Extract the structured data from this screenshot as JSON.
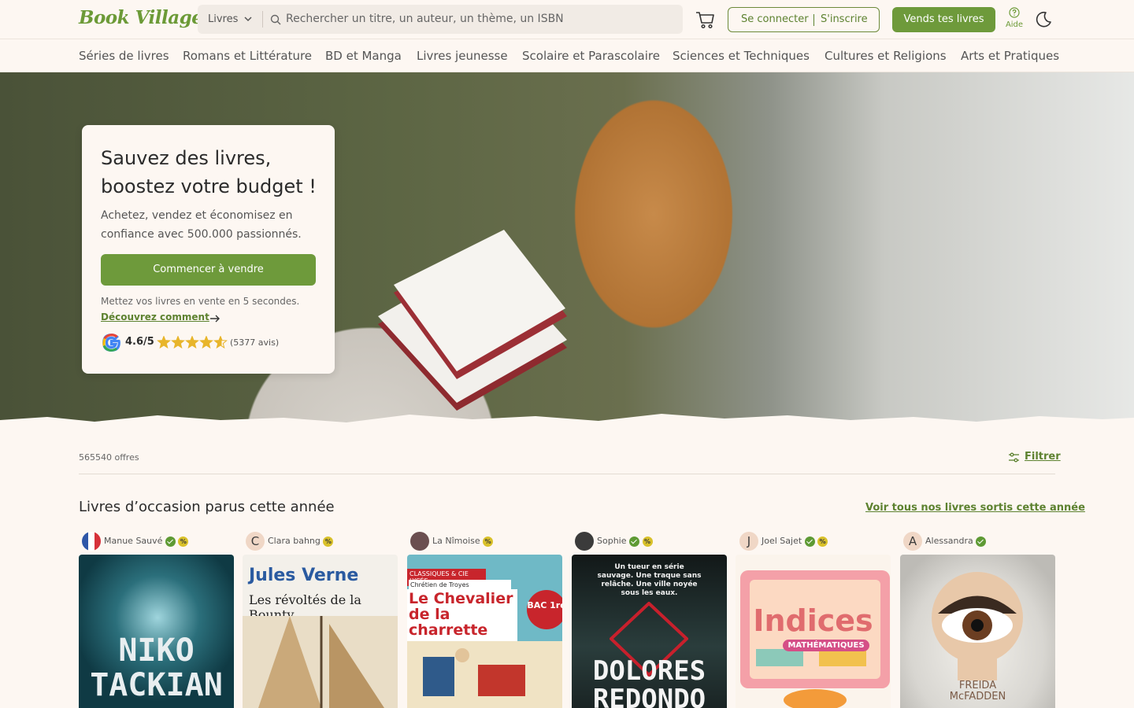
{
  "header": {
    "logo": "Book Village",
    "search_category": "Livres",
    "search_placeholder": "Rechercher un titre, un auteur, un thème, un ISBN",
    "login": "Se connecter",
    "signup": "S'inscrire",
    "sell": "Vends tes livres",
    "help": "Aide"
  },
  "categories": [
    "Séries de livres",
    "Romans et Littérature",
    "BD et Manga",
    "Livres jeunesse",
    "Scolaire et Parascolaire",
    "Sciences et Techniques",
    "Cultures et Religions",
    "Arts et Pratiques"
  ],
  "hero": {
    "title": "Sauvez des livres, boostez votre budget !",
    "subtitle": "Achetez, vendez et économisez en confiance avec 500.000 passionnés.",
    "cta": "Commencer à vendre",
    "hint": "Mettez vos livres en vente en 5 secondes.",
    "discover": "Découvrez comment",
    "rating": "4.6/5",
    "reviews": "(5377 avis)",
    "stars_value": 4.6
  },
  "listing": {
    "offers": "565540 offres",
    "filter": "Filtrer",
    "section_title": "Livres d’occasion parus cette année",
    "see_all": "Voir tous nos livres sortis cette année"
  },
  "books": [
    {
      "seller": "Manue Sauvé",
      "initial": "",
      "verified": true,
      "pro": true,
      "cover_title": "NIKO TACKIAN",
      "cover_bg": "#0f3a44"
    },
    {
      "seller": "Clara bahng",
      "initial": "C",
      "verified": false,
      "pro": true,
      "cover_author": "Jules Verne",
      "cover_title": "Les révoltés de la Bounty",
      "cover_bg": "#f3f0ea"
    },
    {
      "seller": "La Nîmoise",
      "initial": "",
      "verified": false,
      "pro": true,
      "cover_tag": "CLASSIQUES & CIE LYCÉE",
      "cover_author": "Chrétien de Troyes",
      "cover_title": "Le Chevalier de la charrette",
      "cover_badge": "BAC 1re",
      "cover_bg": "#6fb9c6"
    },
    {
      "seller": "Sophie",
      "initial": "",
      "verified": true,
      "pro": true,
      "cover_tagline": "Un tueur en série sauvage. Une traque sans relâche. Une ville noyée sous les eaux.",
      "cover_title": "DOLORES REDONDO",
      "cover_bg": "#1d2a2a"
    },
    {
      "seller": "Joel Sajet",
      "initial": "J",
      "verified": true,
      "pro": true,
      "cover_title": "Indices",
      "cover_sub": "MATHÉMATIQUES",
      "cover_bg": "#f6e5d7"
    },
    {
      "seller": "Alessandra",
      "initial": "A",
      "verified": true,
      "pro": false,
      "cover_title": "FREIDA McFADDEN",
      "cover_bg": "#d9d8d4"
    }
  ],
  "colors": {
    "brand_green": "#6e9a3b",
    "link_green": "#5d8230",
    "background": "#fdf7f2",
    "star": "#e8b52b"
  }
}
